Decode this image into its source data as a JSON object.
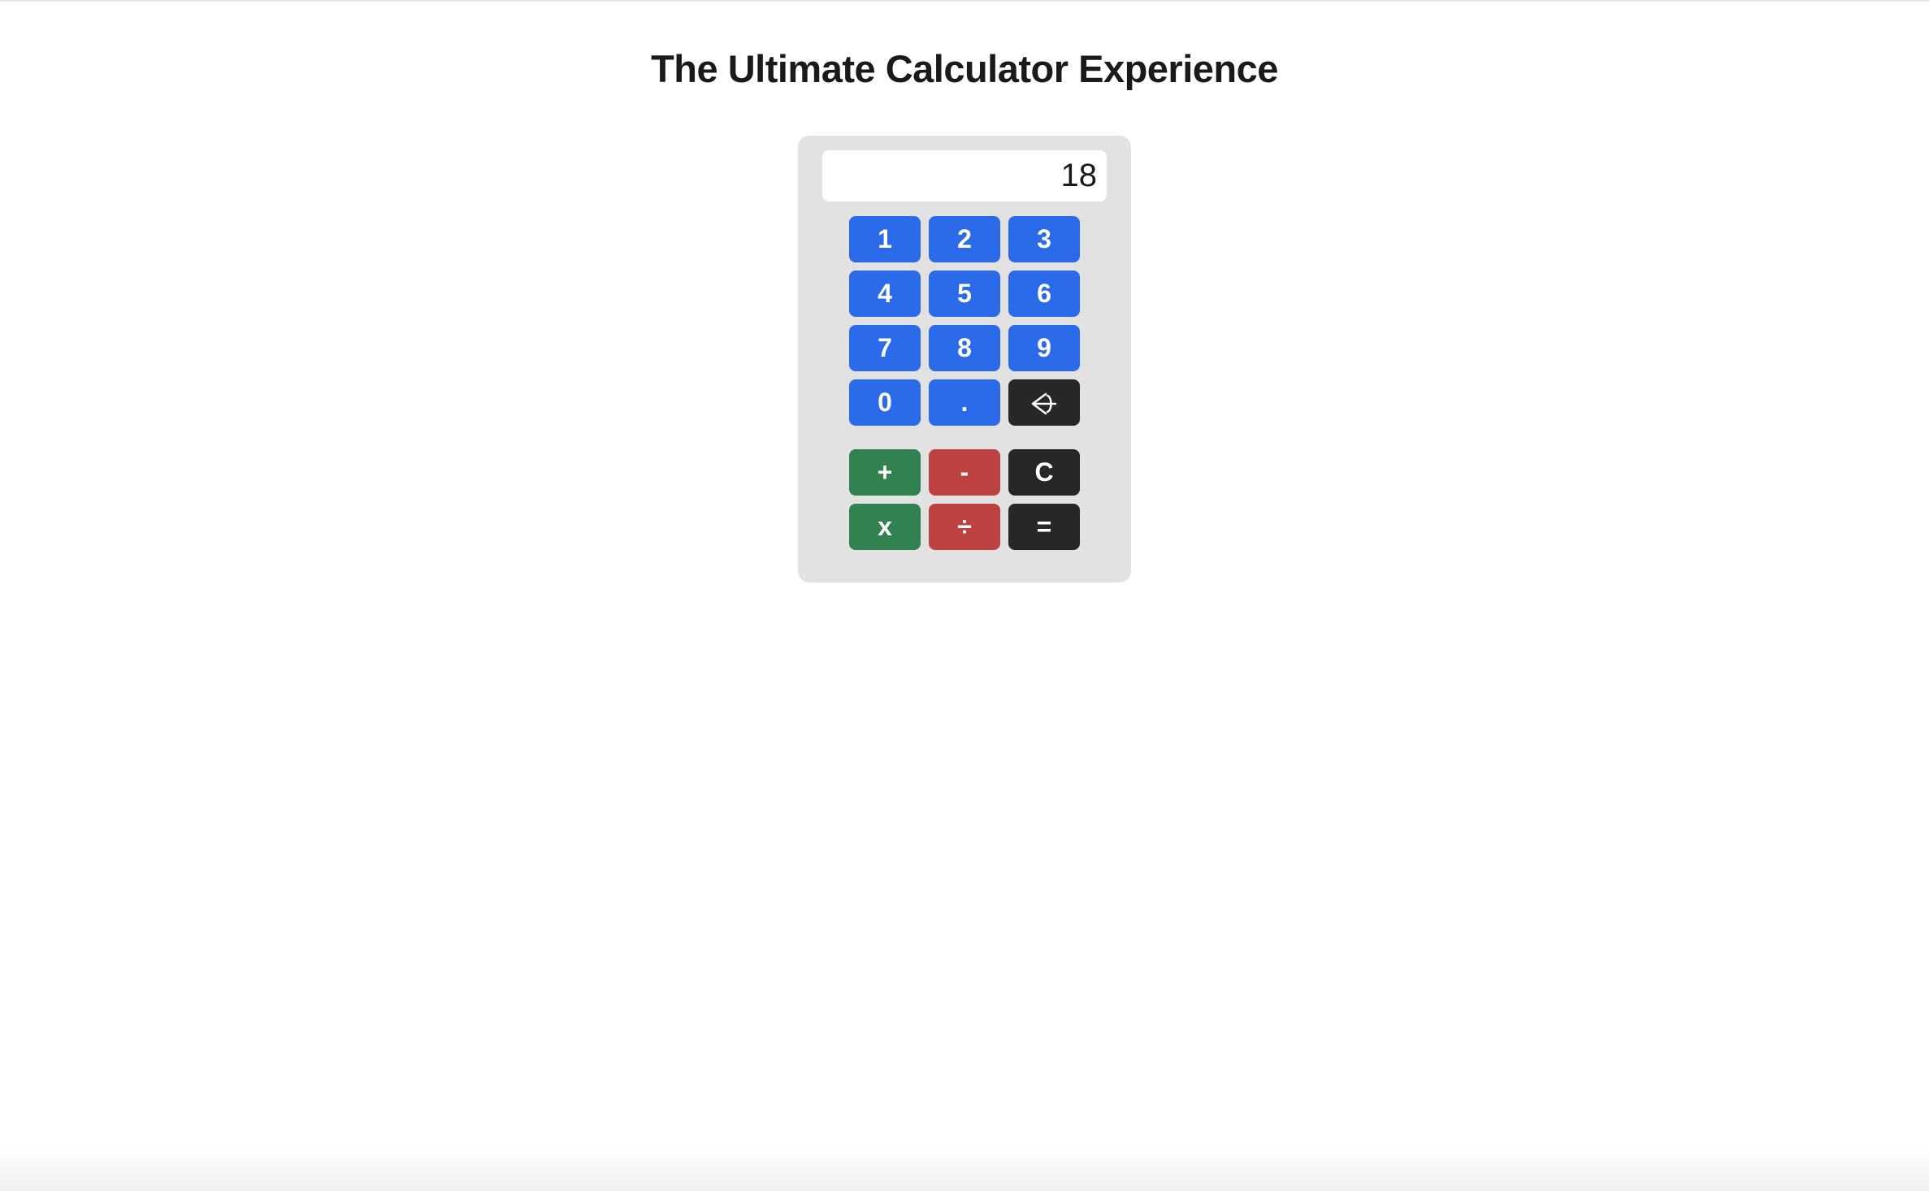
{
  "header": {
    "title": "The Ultimate Calculator Experience"
  },
  "calc": {
    "display_value": "18",
    "keys": {
      "n1": "1",
      "n2": "2",
      "n3": "3",
      "n4": "4",
      "n5": "5",
      "n6": "6",
      "n7": "7",
      "n8": "8",
      "n9": "9",
      "n0": "0",
      "decimal": ".",
      "add": "+",
      "subtract": "-",
      "clear": "C",
      "multiply": "x",
      "divide": "÷",
      "equals": "="
    }
  }
}
